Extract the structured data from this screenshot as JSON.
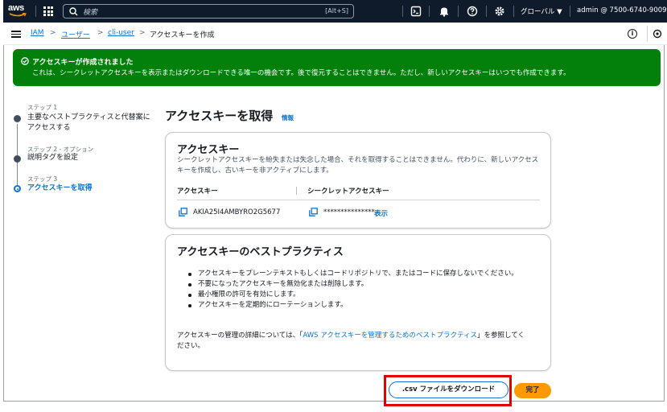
{
  "topbar": {
    "logo": "aws",
    "search_placeholder": "検索",
    "search_shortcut": "[Alt+S]",
    "region": "グローバル ▼",
    "account": "admin @ 7500-6740-9009 ▼",
    "icons": [
      "terminal-icon",
      "bell-icon",
      "help-icon",
      "gear-icon"
    ]
  },
  "breadcrumb": {
    "items": [
      "IAM",
      "ユーザー",
      "cli-user",
      "アクセスキーを作成"
    ],
    "separator": ">"
  },
  "flash": {
    "title": "アクセスキーが作成されました",
    "message": "これは、シークレットアクセスキーを表示またはダウンロードできる唯一の機会です。後で復元することはできません。ただし、新しいアクセスキーはいつでも作成できます。",
    "color": "#037f0c"
  },
  "steps": [
    {
      "num": "ステップ 1",
      "label": "主要なベストプラクティスと代替案にアクセスする",
      "active": false
    },
    {
      "num": "ステップ 2 - オプション",
      "label": "説明タグを設定",
      "active": false
    },
    {
      "num": "ステップ 3",
      "label": "アクセスキーを取得",
      "active": true
    }
  ],
  "main": {
    "title": "アクセスキーを取得",
    "info_link": "情報"
  },
  "access_key_card": {
    "title": "アクセスキー",
    "description": "シークレットアクセスキーを紛失または失念した場合、それを取得することはできません。代わりに、新しいアクセスキーを作成し、古いキーを非アクティブにします。",
    "col_access_key": "アクセスキー",
    "col_secret_key": "シークレットアクセスキー",
    "access_key_value": "AKIA25I4AMBYRO2G5677",
    "secret_key_masked": "***************",
    "show_label": "表示"
  },
  "best_practices_card": {
    "title": "アクセスキーのベストプラクティス",
    "items": [
      "アクセスキーをプレーンテキストもしくはコードリポジトリで、またはコードに保存しないでください。",
      "不要になったアクセスキーを無効化または削除します。",
      "最小権限の許可を有効にします。",
      "アクセスキーを定期的にローテーションします。"
    ],
    "footer_prefix": "アクセスキーの管理の詳細については、「",
    "footer_link": "AWS アクセスキーを管理するためのベストプラクティス",
    "footer_suffix": "」を参照してください。"
  },
  "actions": {
    "download_label": ".csv ファイルをダウンロード",
    "done_label": "完了"
  },
  "colors": {
    "link": "#0972d3",
    "primary_button": "#ff9900",
    "nav_bg": "#0f1b2a",
    "highlight": "#e00000"
  }
}
